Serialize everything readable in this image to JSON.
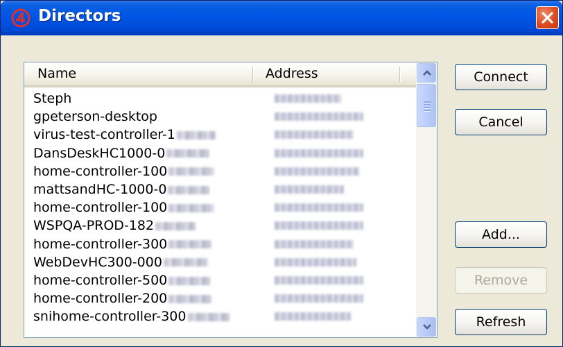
{
  "window": {
    "title": "Directors"
  },
  "list": {
    "columns": [
      "Name",
      "Address"
    ],
    "rows": [
      {
        "name": "Steph",
        "blurred_suffix": false
      },
      {
        "name": "gpeterson-desktop",
        "blurred_suffix": false
      },
      {
        "name": "virus-test-controller-1",
        "blurred_suffix": true
      },
      {
        "name": "DansDeskHC1000-0",
        "blurred_suffix": true
      },
      {
        "name": "home-controller-100",
        "blurred_suffix": true
      },
      {
        "name": "mattsandHC-1000-0",
        "blurred_suffix": true
      },
      {
        "name": "home-controller-100",
        "blurred_suffix": true
      },
      {
        "name": "WSPQA-PROD-182",
        "blurred_suffix": true
      },
      {
        "name": "home-controller-300",
        "blurred_suffix": true
      },
      {
        "name": "WebDevHC300-000",
        "blurred_suffix": true
      },
      {
        "name": "home-controller-500",
        "blurred_suffix": true
      },
      {
        "name": "home-controller-200",
        "blurred_suffix": true
      },
      {
        "name": "snihome-controller-300",
        "blurred_suffix": true
      }
    ]
  },
  "buttons": {
    "connect": "Connect",
    "cancel": "Cancel",
    "add": "Add...",
    "remove": "Remove",
    "refresh": "Refresh"
  },
  "colors": {
    "titlebar": "#0055e5",
    "close_button": "#dd4a20",
    "dialog_bg": "#ece9d8",
    "disabled_text": "#aca899"
  },
  "icons": {
    "app": "red-swirl-logo-icon",
    "close": "close-x-icon",
    "scroll_up": "chevron-up-icon",
    "scroll_down": "chevron-down-icon"
  }
}
